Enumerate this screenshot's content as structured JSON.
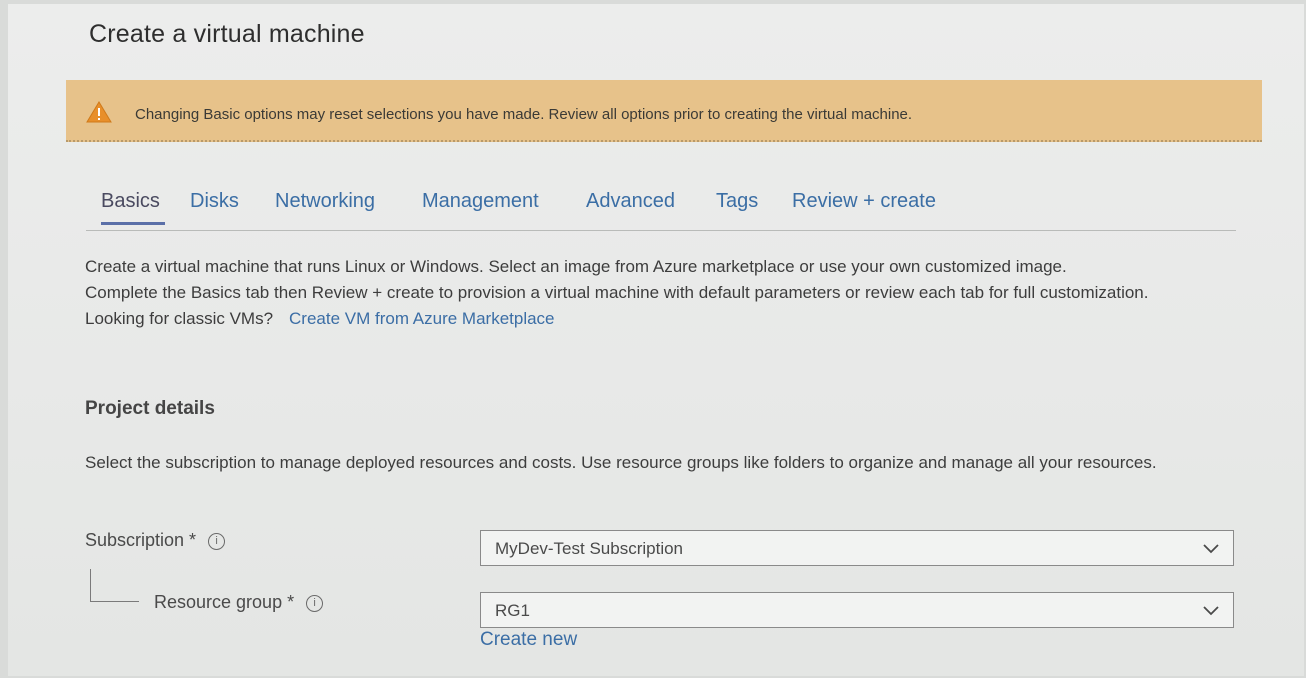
{
  "page": {
    "title": "Create a virtual machine"
  },
  "warning": {
    "icon": "warning-triangle-icon",
    "text": "Changing Basic options may reset selections you have made. Review all options prior to creating the virtual machine."
  },
  "tabs": [
    {
      "label": "Basics",
      "active": true
    },
    {
      "label": "Disks",
      "active": false
    },
    {
      "label": "Networking",
      "active": false
    },
    {
      "label": "Management",
      "active": false
    },
    {
      "label": "Advanced",
      "active": false
    },
    {
      "label": "Tags",
      "active": false
    },
    {
      "label": "Review + create",
      "active": false
    }
  ],
  "intro": {
    "line1": "Create a virtual machine that runs Linux or Windows. Select an image from Azure marketplace or use your own customized image.",
    "line2": "Complete the Basics tab then Review + create to provision a virtual machine with default parameters or review each tab for full customization.",
    "classic_prompt": "Looking for classic VMs?",
    "classic_link": "Create VM from Azure Marketplace"
  },
  "project_details": {
    "heading": "Project details",
    "description": "Select the subscription to manage deployed resources and costs. Use resource groups like folders to organize and manage all your resources."
  },
  "fields": {
    "subscription": {
      "label": "Subscription *",
      "value": "MyDev-Test Subscription",
      "info_icon": "info-icon",
      "dropdown_icon": "chevron-down-icon"
    },
    "resource_group": {
      "label": "Resource group *",
      "value": "RG1",
      "info_icon": "info-icon",
      "dropdown_icon": "chevron-down-icon",
      "create_new": "Create new"
    }
  },
  "colors": {
    "warning_bg": "#e7c28a",
    "link": "#3b6ea5",
    "active_tab_underline": "#5b6fa8"
  }
}
